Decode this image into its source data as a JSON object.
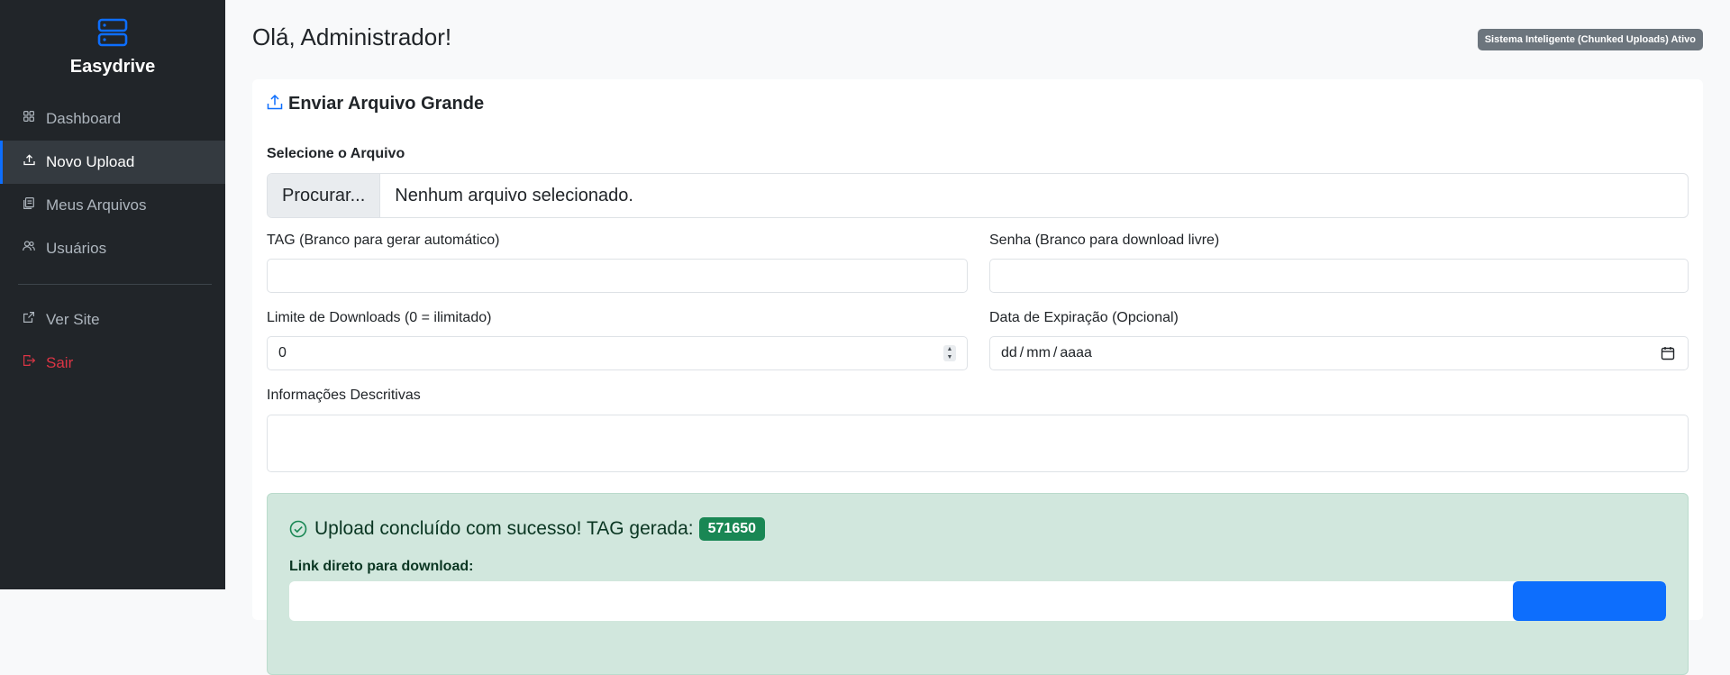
{
  "app": {
    "name": "Easydrive",
    "accent": "#0d6efd"
  },
  "sidebar": {
    "items": [
      {
        "label": "Dashboard",
        "icon": "grid-icon"
      },
      {
        "label": "Novo Upload",
        "icon": "upload-icon",
        "active": true
      },
      {
        "label": "Meus Arquivos",
        "icon": "files-icon"
      },
      {
        "label": "Usuários",
        "icon": "users-icon"
      }
    ],
    "footer_items": [
      {
        "label": "Ver Site",
        "icon": "external-link-icon"
      },
      {
        "label": "Sair",
        "icon": "logout-icon",
        "color": "#dc3545"
      }
    ]
  },
  "header": {
    "title": "Olá, Administrador!",
    "system_badge": "Sistema Inteligente (Chunked Uploads) Ativo"
  },
  "form": {
    "card_title": "Enviar Arquivo Grande",
    "file": {
      "label": "Selecione o Arquivo",
      "button": "Procurar...",
      "status": "Nenhum arquivo selecionado."
    },
    "tag": {
      "label": "TAG (Branco para gerar automático)",
      "value": ""
    },
    "password": {
      "label": "Senha (Branco para download livre)",
      "value": ""
    },
    "download_limit": {
      "label": "Limite de Downloads (0 = ilimitado)",
      "value": "0"
    },
    "expiration": {
      "label": "Data de Expiração (Opcional)",
      "day": "dd",
      "month": "mm",
      "year": "aaaa"
    },
    "description": {
      "label": "Informações Descritivas",
      "value": ""
    }
  },
  "result": {
    "message": "Upload concluído com sucesso! TAG gerada:",
    "tag": "571650",
    "link_label": "Link direto para download:",
    "bg_color": "#d1e7dd",
    "badge_color": "#198754"
  }
}
